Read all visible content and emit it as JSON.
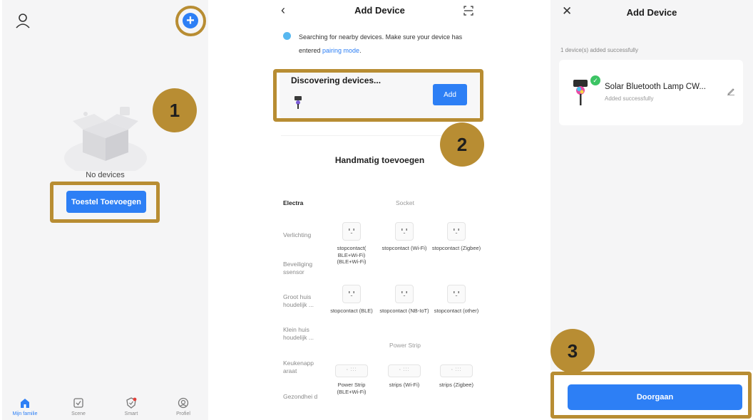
{
  "screen1": {
    "empty_text": "No devices",
    "add_button": "Toestel Toevoegen",
    "tabs": [
      {
        "label": "Mijn familie",
        "icon": "home-icon"
      },
      {
        "label": "Scene",
        "icon": "checkbox-icon"
      },
      {
        "label": "Smart",
        "icon": "shield-icon"
      },
      {
        "label": "Profiel",
        "icon": "profile-icon"
      }
    ],
    "plus_icon": "+"
  },
  "screen2": {
    "title": "Add Device",
    "back_icon": "‹",
    "search_text": "Searching for nearby devices. Make sure your device has entered ",
    "search_link": "pairing mode",
    "search_end": ".",
    "discover_title": "Discovering devices...",
    "discover_add": "Add",
    "manual_title": "Handmatig toevoegen",
    "categories": [
      "Electra",
      "Verlichting",
      "Beveiliging ssensor",
      "Groot huis houdelijk ...",
      "Klein huis houdelijk ...",
      "Keukenapp araat",
      "Gezondhei d"
    ],
    "section_socket": "Socket",
    "section_strip": "Power Strip",
    "devices_row1": [
      "stopcontact( BLE+Wi-Fi) (BLE+Wi-Fi)",
      "stopcontact (Wi-Fi)",
      "stopcontact (Zigbee)"
    ],
    "devices_row2": [
      "stopcontact (BLE)",
      "stopcontact (NB-IoT)",
      "stopcontact (other)"
    ],
    "devices_row3": [
      "Power Strip (BLE+Wi-Fi)",
      "strips (Wi-Fi)",
      "strips (Zigbee)"
    ]
  },
  "screen3": {
    "title": "Add Device",
    "close_icon": "✕",
    "added_count": "1 device(s) added successfully",
    "device_name": "Solar Bluetooth Lamp CW...",
    "device_status": "Added successfully",
    "continue_button": "Doorgaan"
  },
  "markers": [
    "1",
    "2",
    "3"
  ],
  "colors": {
    "accent": "#2d7ff5",
    "highlight": "#b88d33",
    "success": "#3cc464"
  }
}
